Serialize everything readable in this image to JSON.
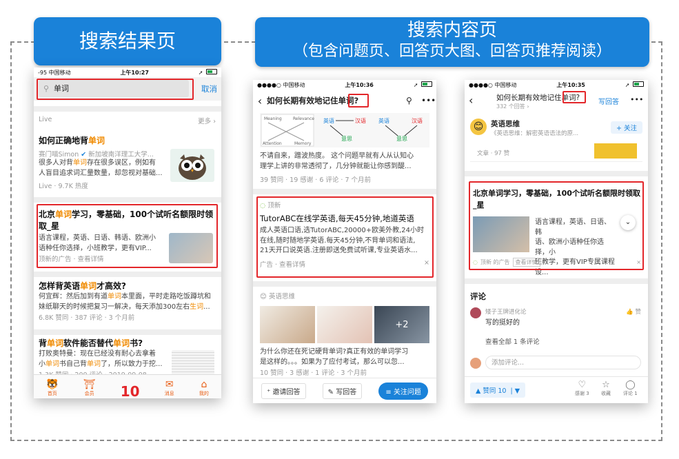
{
  "labels": {
    "left": "搜索结果页",
    "right_line1": "搜索内容页",
    "right_line2": "（包含问题页、回答页大图、回答页推荐阅读）"
  },
  "phone1": {
    "status": {
      "carrier": "-95 中国移动",
      "time": "上午10:27"
    },
    "search": {
      "value": "单词",
      "icon": "search-icon",
      "cancel": "取消"
    },
    "live_header": {
      "label": "Live",
      "more": "更多 ›"
    },
    "result1": {
      "title": [
        "如何正确地背",
        "单词"
      ],
      "author": "赛门喵Simon",
      "author_desc": "新加坡南洋理工大学...",
      "snippet1": [
        "很多人对背",
        "单词",
        "存在很多误区，例如有"
      ],
      "snippet2": "人盲目追求词汇量数量，却忽视对基础...",
      "meta": "Live · 9.7K 热度"
    },
    "ad": {
      "title": [
        "北京",
        "单词",
        "学习，零基础，100个试听名额限时领取_星"
      ],
      "text1": "语言课程，英语、日语、韩语、欧洲小",
      "text2": "语种任你选择，小班教学，更有VIP...",
      "meta": "顶新的广告 · 查看详情"
    },
    "result3": {
      "title": [
        "怎样背英语",
        "单词",
        "才高效?"
      ],
      "line1": [
        "何宜辉：然后加到有道",
        "单词",
        "本里面，平时走路吃饭蹲坑和"
      ],
      "line2": [
        "妹纸聊天的时候把复习一解决，每天添加300左右",
        "生词",
        "..."
      ],
      "meta": "6.8K 赞同 · 387 评论 · 3 个月前"
    },
    "result4": {
      "title": [
        "背",
        "单词",
        "软件能否替代",
        "单词",
        "书?"
      ],
      "line1": "打败奥特曼：现在已经没有耐心去拿着",
      "line2": [
        "小",
        "单词",
        "书自己背",
        "单词",
        "了，所以致力于挖..."
      ],
      "meta": "1.3K 赞同 · 200 评论 · 2019-09-08"
    },
    "tabbar": [
      "首页",
      "会员",
      "10",
      "消息",
      "我的"
    ]
  },
  "phone2": {
    "status": {
      "carrier": "●●●●○ 中国移动",
      "time": "上午10:36"
    },
    "title": [
      "如何长期有效地记住",
      "单词",
      "?"
    ],
    "diagram": {
      "meaning": "Meaning",
      "relevance": "Relevance",
      "attention": "Attention",
      "memory": "Memory",
      "en": "英语",
      "zh": "汉语",
      "yi": "意思"
    },
    "answer1": {
      "text1": "不请自来，蹭波热度。 这个问题早就有人从认知心",
      "text2": "理学上讲的非常透彻了，几分钟就能让你感到醍...",
      "meta": "39 赞同 · 19 感谢 · 6 评论 · 7 个月前"
    },
    "ad": {
      "brand": "顶新",
      "title": "TutorABC在线学英语,每天45分钟,地道英语",
      "line1": "成人英语口语,选TutorABC,20000+欧美外教,24小时",
      "line2": "在线,随时随地学英语.每天45分钟,不背单词和语法,",
      "line3": "21天开口说英语.注册即送免费试听课,专业英语水...",
      "meta": "广告 · 查看详情",
      "close": "×"
    },
    "answer2": {
      "author": "英语思维",
      "plus": "+2",
      "text1": "为什么你还在死记硬背单词?真正有效的单词学习",
      "text2": "是这样的。。。如果为了应付考试，那么可以忽...",
      "meta": "10 赞同 · 3 感谢 · 1 评论 · 3 个月前"
    },
    "actions": {
      "invite": "邀请回答",
      "write": "写回答",
      "follow": "关注问题"
    }
  },
  "phone3": {
    "status": {
      "carrier": "●●●●○ 中国移动",
      "time": "上午10:35"
    },
    "title": [
      "如何长期有效地记住",
      "单词",
      "?"
    ],
    "sub": "332 个回答 ›",
    "write_answer": "写回答",
    "author": {
      "name": "英语思维",
      "desc": "《英语思维：解密英语语法的原...",
      "follow": "+ 关注"
    },
    "article_meta": "文章 · 97 赞",
    "ad": {
      "title": "北京单词学习，零基础，100个试听名额限时领取_星",
      "line1": "语言课程，英语、日语、韩",
      "line2": "语、欧洲小语种任你选择，小",
      "line3": "班教学，更有VIP专属课程设...",
      "meta": "顶新 的广告",
      "detail": "查看详情",
      "close": "×"
    },
    "comments": {
      "header": "评论",
      "user": "矮子王牌进化论",
      "text": "写的挺好的",
      "like": "赞",
      "view_all": "查看全部 1 条评论",
      "placeholder": "添加评论..."
    },
    "bottom": {
      "upvote": "赞同 10",
      "thanks": "感谢 3",
      "collect": "收藏",
      "comment": "评论 1"
    }
  },
  "colors": {
    "accent": "#1a82d9",
    "highlight": "#f08a00",
    "red_box": "#e3262a"
  }
}
